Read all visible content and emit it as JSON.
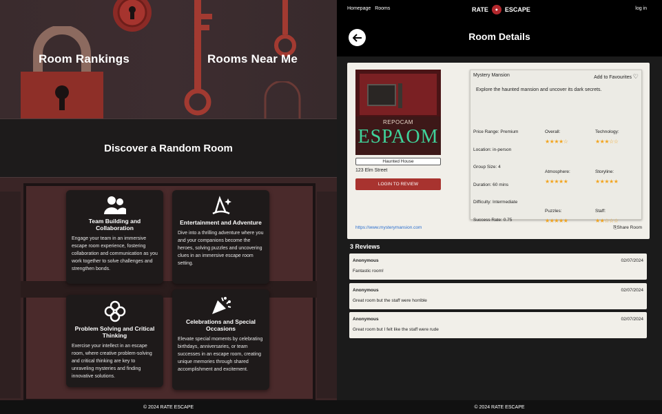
{
  "left": {
    "tiles": [
      "Room Rankings",
      "Rooms Near Me"
    ],
    "random": "Discover a Random Room",
    "cards": [
      {
        "title": "Team Building and Collaboration",
        "text": "Engage your team in an immersive escape room experience, fostering collaboration and communication as you work together to solve challenges and strengthen bonds.",
        "icon": "users-icon"
      },
      {
        "title": "Entertainment and Adventure",
        "text": "Dive into a thrilling adventure where you and your companions become the heroes, solving puzzles and uncovering clues in an immersive escape room setting.",
        "icon": "wizard-hat-icon"
      },
      {
        "title": "Problem Solving and Critical Thinking",
        "text": "Exercise your intellect in an escape room, where creative problem-solving and critical thinking are key to unraveling mysteries and finding innovative solutions.",
        "icon": "puzzle-icon"
      },
      {
        "title": "Celebrations and Special Occasions",
        "text": "Elevate special moments by celebrating birthdays, anniversaries, or team successes in an escape room, creating unique memories through shared accomplishment and excitement.",
        "icon": "party-popper-icon"
      }
    ],
    "footer": "© 2024 RATE ESCAPE"
  },
  "right": {
    "nav": {
      "homepage": "Homepage",
      "rooms": "Rooms",
      "brand_left": "RATE",
      "brand_right": "ESCAPE",
      "login": "log in"
    },
    "title": "Room Details",
    "room": {
      "name": "Mystery Mansion",
      "favourite": "Add to Favourites",
      "description": "Explore the haunted mansion and uncover its dark secrets.",
      "cover_top": "REPOCAM",
      "cover_main": "ESPAOM",
      "genre": "Haunted House",
      "address": "123 Elm Street",
      "login_review": "LOGIN TO REVIEW",
      "url": "https://www.mysterymansion.com",
      "share": "Share Room",
      "price": "Price Range: Premium",
      "location": "Location: in-person",
      "group": "Group Size: 4",
      "duration": "Duration: 60 mins",
      "difficulty": "Difficulty: Intermediate",
      "success": "Success Rate: 0.75",
      "ratings": [
        {
          "label": "Overall:",
          "stars": "★★★★☆"
        },
        {
          "label": "Technology:",
          "stars": "★★★☆☆"
        },
        {
          "label": "Atmosphere:",
          "stars": "★★★★★"
        },
        {
          "label": "Storyline:",
          "stars": "★★★★★"
        },
        {
          "label": "Puzzles:",
          "stars": "★★★★★"
        },
        {
          "label": "Staff:",
          "stars": "★★☆☆☆"
        }
      ]
    },
    "reviews_header": "3 Reviews",
    "reviews": [
      {
        "author": "Anonymous",
        "date": "02/07/2024",
        "text": "Fantastic room!"
      },
      {
        "author": "Anonymous",
        "date": "02/07/2024",
        "text": "Great room but the staff were horrible"
      },
      {
        "author": "Anonymous",
        "date": "02/07/2024",
        "text": "Great room but I felt like the staff were rude"
      }
    ],
    "footer": "© 2024 RATE ESCAPE"
  }
}
